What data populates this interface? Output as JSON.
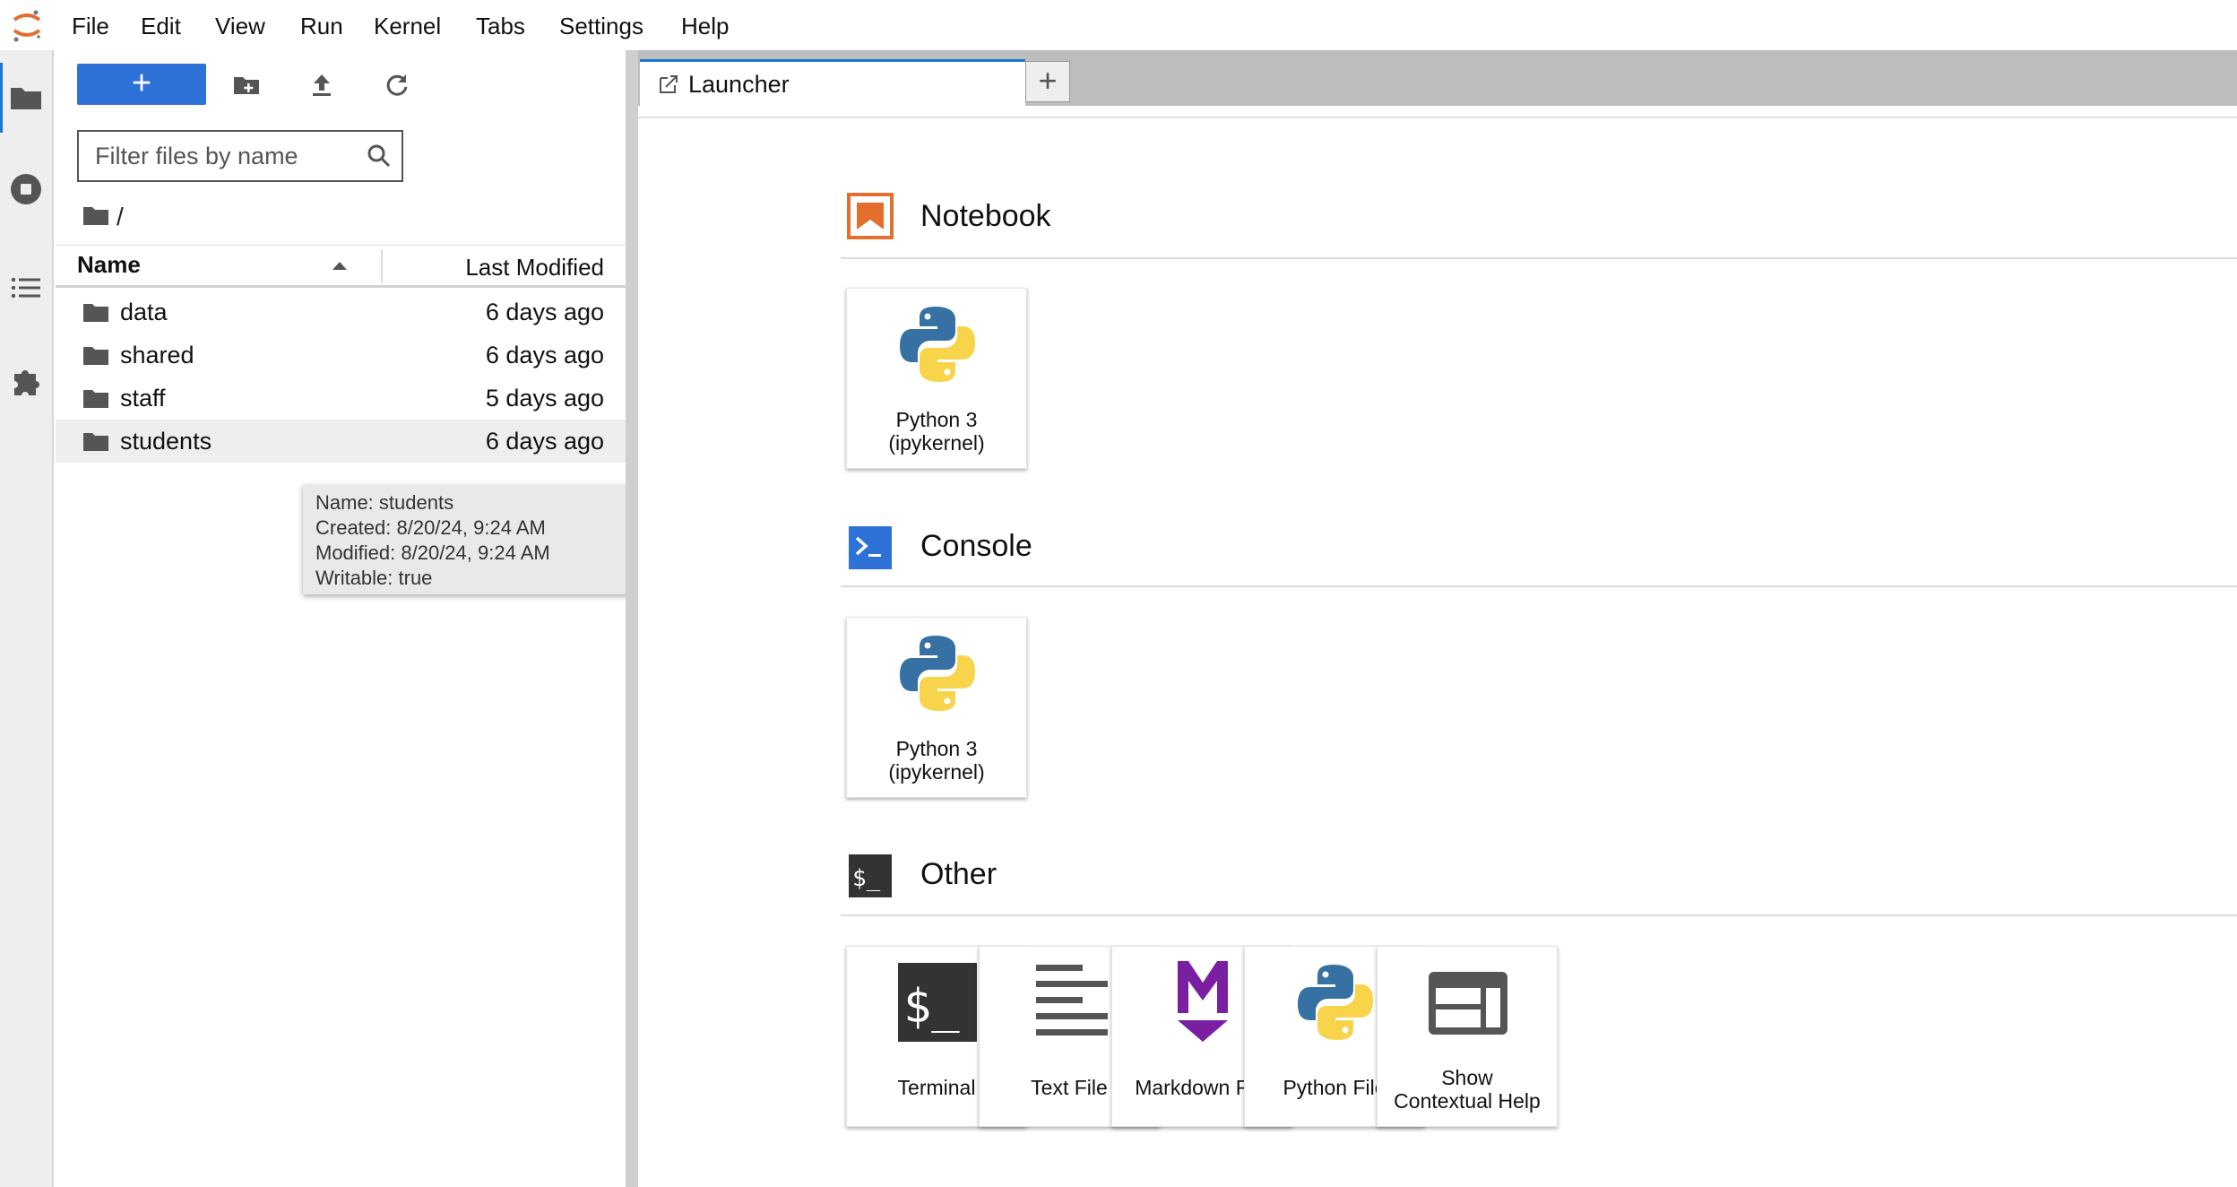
{
  "menubar": {
    "items": [
      "File",
      "Edit",
      "View",
      "Run",
      "Kernel",
      "Tabs",
      "Settings",
      "Help"
    ]
  },
  "activitybar": {
    "icons": [
      "folder-icon",
      "running-stop-icon",
      "table-of-contents-icon",
      "extension-puzzle-icon"
    ]
  },
  "filebrowser": {
    "new_label": "+",
    "filter_placeholder": "Filter files by name",
    "breadcrumb": "/",
    "columns": {
      "name": "Name",
      "last_modified": "Last Modified"
    },
    "files": [
      {
        "name": "data",
        "modified": "6 days ago"
      },
      {
        "name": "shared",
        "modified": "6 days ago"
      },
      {
        "name": "staff",
        "modified": "5 days ago"
      },
      {
        "name": "students",
        "modified": "6 days ago"
      }
    ],
    "tooltip": {
      "name": "Name: students",
      "created": "Created: 8/20/24, 9:24 AM",
      "modified": "Modified: 8/20/24, 9:24 AM",
      "writable": "Writable: true"
    }
  },
  "main": {
    "tab_label": "Launcher",
    "tab_add": "+",
    "sections": {
      "notebook": {
        "title": "Notebook",
        "cards": [
          {
            "line1": "Python 3",
            "line2": "(ipykernel)"
          }
        ]
      },
      "console": {
        "title": "Console",
        "cards": [
          {
            "line1": "Python 3",
            "line2": "(ipykernel)"
          }
        ]
      },
      "other": {
        "title": "Other",
        "cards": [
          {
            "line1": "Terminal"
          },
          {
            "line1": "Text File"
          },
          {
            "line1": "Markdown File"
          },
          {
            "line1": "Python File"
          },
          {
            "line1": "Show",
            "line2": "Contextual Help"
          }
        ],
        "terminal_glyph": "$_"
      }
    }
  },
  "colors": {
    "accent": "#2f72d7",
    "notebook_orange": "#e46e2e",
    "console_blue": "#2f72d7",
    "terminal_dark": "#333333",
    "markdown_purple": "#7b1fa2",
    "python_blue": "#3771a3",
    "python_yellow": "#f7d44a"
  }
}
